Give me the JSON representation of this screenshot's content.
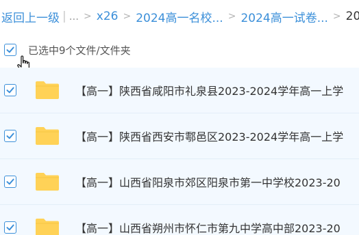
{
  "breadcrumb": {
    "back": "返回上一级",
    "ellipsis": "...",
    "items": [
      "x26",
      "2024高一名校...",
      "2024高一试卷..."
    ],
    "current": "20"
  },
  "selection": {
    "text": "已选中9个文件/文件夹"
  },
  "files": [
    {
      "name": "【高一】陕西省咸阳市礼泉县2023-2024学年高一上学"
    },
    {
      "name": "【高一】陕西省西安市鄠邑区2023-2024学年高一上学"
    },
    {
      "name": "【高一】山西省阳泉市郊区阳泉市第一中学校2023-20"
    },
    {
      "name": "【高一】山西省朔州市怀仁市第九中学高中部2023-20"
    }
  ],
  "colors": {
    "accent": "#3b8fd9",
    "folder": "#ffd257",
    "row_background": "#f3f9ff"
  }
}
